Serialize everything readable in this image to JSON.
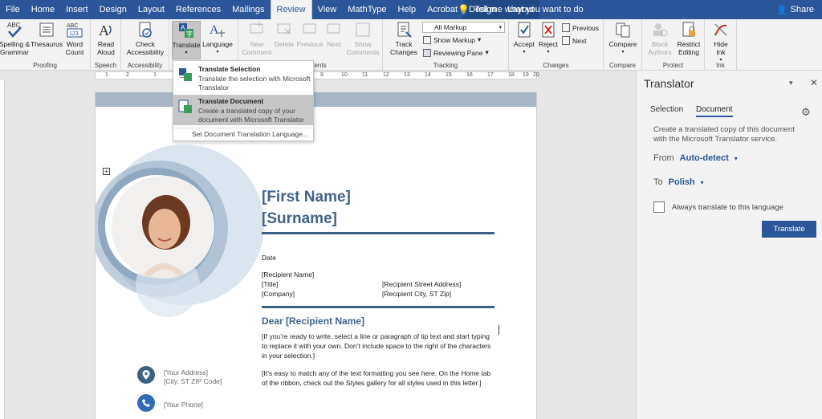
{
  "tabs": [
    "File",
    "Home",
    "Insert",
    "Design",
    "Layout",
    "References",
    "Mailings",
    "Review",
    "View",
    "MathType",
    "Help",
    "Acrobat",
    "Design",
    "Layout"
  ],
  "active_tab": "Review",
  "tell_me": "Tell me what you want to do",
  "share": "Share",
  "ribbon": {
    "spelling": "Spelling &\nGrammar",
    "thesaurus": "Thesaurus",
    "word_count": "Word\nCount",
    "proofing": "Proofing",
    "read_aloud": "Read\nAloud",
    "speech": "Speech",
    "check_accessibility": "Check\nAccessibility",
    "accessibility": "Accessibility",
    "translate": "Translate",
    "language": "Language",
    "new_comment": "New\nComment",
    "delete": "Delete",
    "previous": "Previous",
    "next": "Next",
    "show_comments": "Show\nComments",
    "comments_group": "nents",
    "track_changes": "Track\nChanges",
    "all_markup": "All Markup",
    "show_markup": "Show Markup",
    "reviewing_pane": "Reviewing Pane",
    "tracking": "Tracking",
    "accept": "Accept",
    "reject": "Reject",
    "prev_change": "Previous",
    "next_change": "Next",
    "changes": "Changes",
    "compare": "Compare",
    "compare_group": "Compare",
    "block_authors": "Block\nAuthors",
    "restrict_editing": "Restrict\nEditing",
    "protect": "Protect",
    "hide_ink": "Hide\nInk",
    "ink": "Ink"
  },
  "ruler_marks": [
    "1",
    "2",
    "1",
    "2",
    "3",
    "4",
    "5",
    "6",
    "7",
    "8",
    "9",
    "10",
    "11",
    "12",
    "13",
    "14",
    "15",
    "16",
    "17",
    "18",
    "19",
    "20"
  ],
  "menu": {
    "item1_title": "Translate Selection",
    "item1_desc": "Translate the selection with Microsoft Translator",
    "item2_title": "Translate Document",
    "item2_desc": "Create a translated copy of your document with Microsoft Translator",
    "link": "Set Document Translation Language..."
  },
  "document": {
    "first_name": "[First Name]",
    "surname": "[Surname]",
    "date": "Date",
    "recipient_name": "[Recipient Name]",
    "title": "[Title]",
    "company": "[Company]",
    "street": "[Recipient Street Address]",
    "city": "[Recipient City, ST Zip]",
    "dear": "Dear [Recipient Name]",
    "para1": "[If you’re ready to write, select a line or paragraph of tip text and start typing to replace it with your own. Don’t include space to the right of the characters in your selection.]",
    "para2": "[It’s easy to match any of the text formatting you see here. On the Home tab of the ribbon, check out the Styles gallery for all styles used in this letter.]",
    "address": "[Your Address]",
    "city_zip": "[City, ST ZIP Code]",
    "phone": "[Your Phone]"
  },
  "pane": {
    "title": "Translator",
    "tab_selection": "Selection",
    "tab_document": "Document",
    "description": "Create a translated copy of this document with the Microsoft Translator service.",
    "from_label": "From",
    "from_value": "Auto-detect",
    "to_label": "To",
    "to_value": "Polish",
    "always": "Always translate to this language",
    "button": "Translate"
  },
  "colors": {
    "accent": "#2b579a",
    "heading": "#41638a",
    "highlight": "#c6c6c6"
  }
}
